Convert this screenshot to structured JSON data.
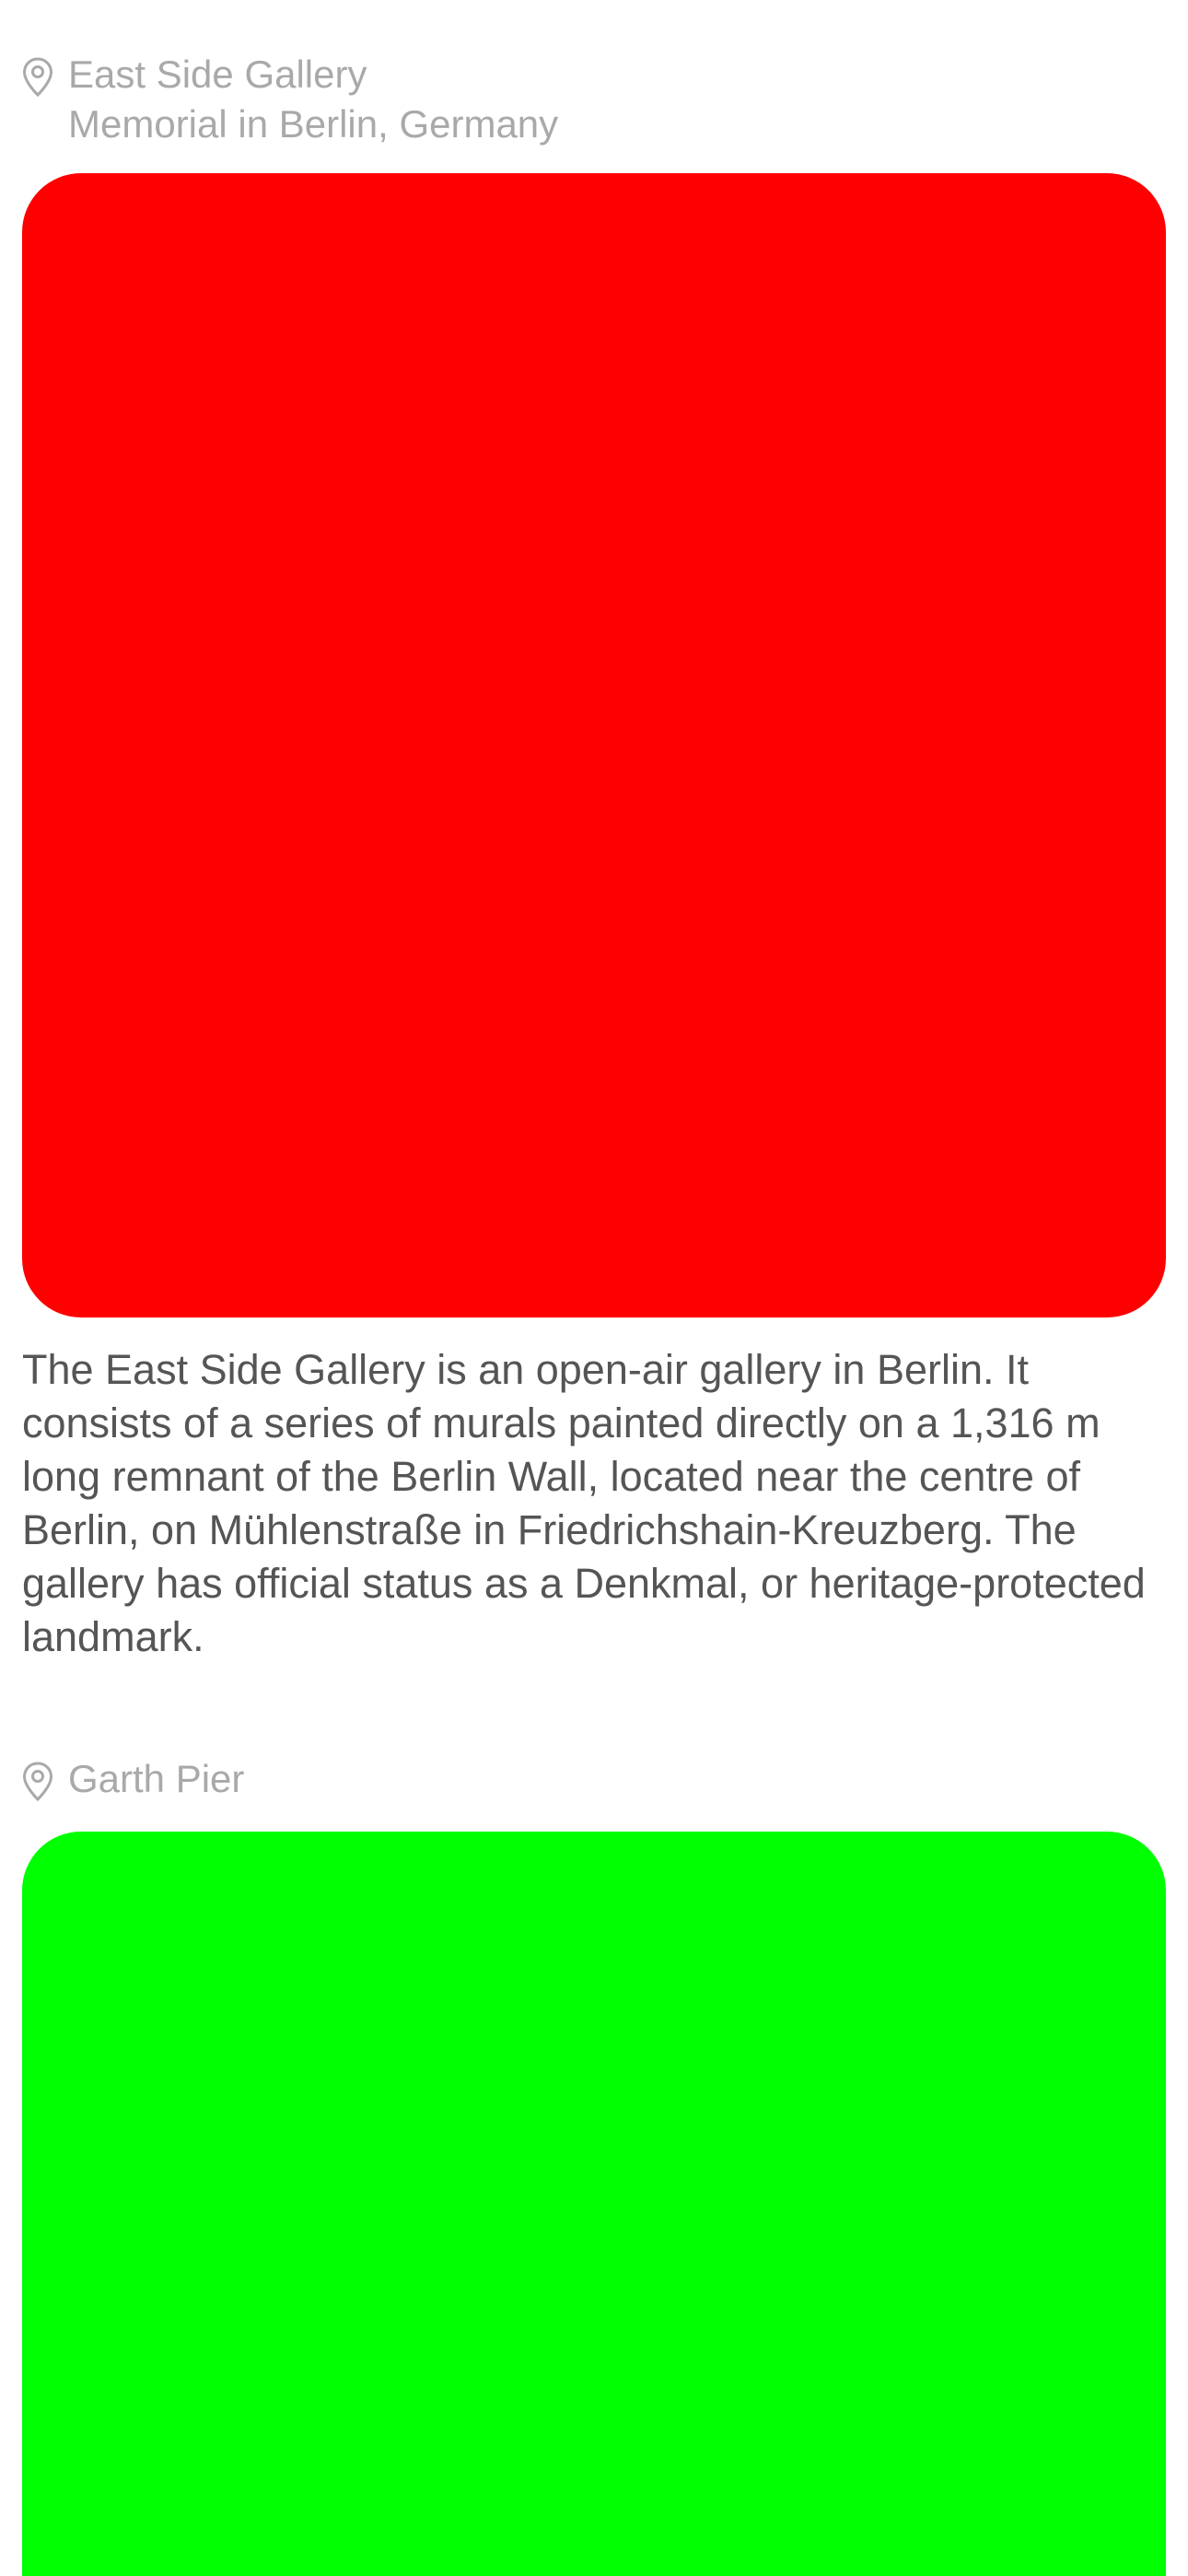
{
  "places": [
    {
      "title": "East Side Gallery",
      "subtitle": "Memorial in Berlin, Germany",
      "image_color": "#ff0000",
      "description": "The East Side Gallery is an open-air gallery in Berlin. It consists of a series of murals painted directly on a 1,316 m long remnant of the Berlin Wall, located near the centre of Berlin, on Mühlenstraße in Friedrichshain-Kreuzberg. The gallery has official status as a Denkmal, or heritage-protected landmark."
    },
    {
      "title": "Garth Pier",
      "image_color": "#00ff00"
    }
  ],
  "icons": {
    "location": "map-pin-icon"
  },
  "colors": {
    "secondary_text": "#a9a9a9",
    "body_text": "#555555",
    "background": "#ffffff"
  }
}
